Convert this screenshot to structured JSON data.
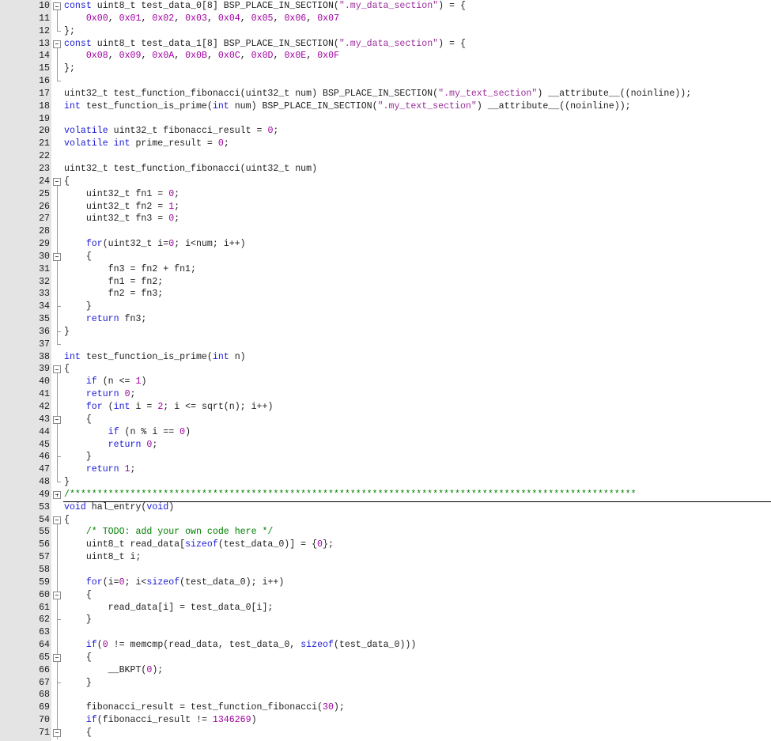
{
  "editor": {
    "lines": [
      {
        "n": "10",
        "fold": "box-start",
        "segs": [
          [
            "kw",
            "const"
          ],
          [
            "p",
            " uint8_t test_data_0[8] BSP_PLACE_IN_SECTION("
          ],
          [
            "str",
            "\".my_data_section\""
          ],
          [
            "p",
            ") = {"
          ]
        ]
      },
      {
        "n": "11",
        "fold": "line",
        "segs": [
          [
            "p",
            "    "
          ],
          [
            "num",
            "0x00"
          ],
          [
            "p",
            ", "
          ],
          [
            "num",
            "0x01"
          ],
          [
            "p",
            ", "
          ],
          [
            "num",
            "0x02"
          ],
          [
            "p",
            ", "
          ],
          [
            "num",
            "0x03"
          ],
          [
            "p",
            ", "
          ],
          [
            "num",
            "0x04"
          ],
          [
            "p",
            ", "
          ],
          [
            "num",
            "0x05"
          ],
          [
            "p",
            ", "
          ],
          [
            "num",
            "0x06"
          ],
          [
            "p",
            ", "
          ],
          [
            "num",
            "0x07"
          ]
        ]
      },
      {
        "n": "12",
        "fold": "end",
        "segs": [
          [
            "p",
            "};"
          ]
        ]
      },
      {
        "n": "13",
        "fold": "box-start",
        "segs": [
          [
            "kw",
            "const"
          ],
          [
            "p",
            " uint8_t test_data_1[8] BSP_PLACE_IN_SECTION("
          ],
          [
            "str",
            "\".my_data_section\""
          ],
          [
            "p",
            ") = {"
          ]
        ]
      },
      {
        "n": "14",
        "fold": "line",
        "segs": [
          [
            "p",
            "    "
          ],
          [
            "num",
            "0x08"
          ],
          [
            "p",
            ", "
          ],
          [
            "num",
            "0x09"
          ],
          [
            "p",
            ", "
          ],
          [
            "num",
            "0x0A"
          ],
          [
            "p",
            ", "
          ],
          [
            "num",
            "0x0B"
          ],
          [
            "p",
            ", "
          ],
          [
            "num",
            "0x0C"
          ],
          [
            "p",
            ", "
          ],
          [
            "num",
            "0x0D"
          ],
          [
            "p",
            ", "
          ],
          [
            "num",
            "0x0E"
          ],
          [
            "p",
            ", "
          ],
          [
            "num",
            "0x0F"
          ]
        ]
      },
      {
        "n": "15",
        "fold": "line",
        "segs": [
          [
            "p",
            "};"
          ]
        ]
      },
      {
        "n": "16",
        "fold": "end",
        "segs": []
      },
      {
        "n": "17",
        "fold": "",
        "segs": [
          [
            "p",
            "uint32_t test_function_fibonacci(uint32_t num) BSP_PLACE_IN_SECTION("
          ],
          [
            "str",
            "\".my_text_section\""
          ],
          [
            "p",
            ") __attribute__((noinline));"
          ]
        ]
      },
      {
        "n": "18",
        "fold": "",
        "segs": [
          [
            "kw",
            "int"
          ],
          [
            "p",
            " test_function_is_prime("
          ],
          [
            "kw",
            "int"
          ],
          [
            "p",
            " num) BSP_PLACE_IN_SECTION("
          ],
          [
            "str",
            "\".my_text_section\""
          ],
          [
            "p",
            ") __attribute__((noinline));"
          ]
        ]
      },
      {
        "n": "19",
        "fold": "",
        "segs": []
      },
      {
        "n": "20",
        "fold": "",
        "segs": [
          [
            "kw",
            "volatile"
          ],
          [
            "p",
            " uint32_t fibonacci_result = "
          ],
          [
            "num",
            "0"
          ],
          [
            "p",
            ";"
          ]
        ]
      },
      {
        "n": "21",
        "fold": "",
        "segs": [
          [
            "kw",
            "volatile"
          ],
          [
            "p",
            " "
          ],
          [
            "kw",
            "int"
          ],
          [
            "p",
            " prime_result = "
          ],
          [
            "num",
            "0"
          ],
          [
            "p",
            ";"
          ]
        ]
      },
      {
        "n": "22",
        "fold": "",
        "segs": []
      },
      {
        "n": "23",
        "fold": "",
        "segs": [
          [
            "p",
            "uint32_t test_function_fibonacci(uint32_t num)"
          ]
        ]
      },
      {
        "n": "24",
        "fold": "box-start",
        "segs": [
          [
            "p",
            "{"
          ]
        ]
      },
      {
        "n": "25",
        "fold": "line",
        "segs": [
          [
            "p",
            "    uint32_t fn1 = "
          ],
          [
            "num",
            "0"
          ],
          [
            "p",
            ";"
          ]
        ]
      },
      {
        "n": "26",
        "fold": "line",
        "segs": [
          [
            "p",
            "    uint32_t fn2 = "
          ],
          [
            "num",
            "1"
          ],
          [
            "p",
            ";"
          ]
        ]
      },
      {
        "n": "27",
        "fold": "line",
        "segs": [
          [
            "p",
            "    uint32_t fn3 = "
          ],
          [
            "num",
            "0"
          ],
          [
            "p",
            ";"
          ]
        ]
      },
      {
        "n": "28",
        "fold": "line",
        "segs": []
      },
      {
        "n": "29",
        "fold": "line",
        "segs": [
          [
            "p",
            "    "
          ],
          [
            "kw",
            "for"
          ],
          [
            "p",
            "(uint32_t i="
          ],
          [
            "num",
            "0"
          ],
          [
            "p",
            "; i<num; i++)"
          ]
        ]
      },
      {
        "n": "30",
        "fold": "box",
        "segs": [
          [
            "p",
            "    {"
          ]
        ]
      },
      {
        "n": "31",
        "fold": "line",
        "segs": [
          [
            "p",
            "        fn3 = fn2 + fn1;"
          ]
        ]
      },
      {
        "n": "32",
        "fold": "line",
        "segs": [
          [
            "p",
            "        fn1 = fn2;"
          ]
        ]
      },
      {
        "n": "33",
        "fold": "line",
        "segs": [
          [
            "p",
            "        fn2 = fn3;"
          ]
        ]
      },
      {
        "n": "34",
        "fold": "tick",
        "segs": [
          [
            "p",
            "    }"
          ]
        ]
      },
      {
        "n": "35",
        "fold": "line",
        "segs": [
          [
            "p",
            "    "
          ],
          [
            "kw",
            "return"
          ],
          [
            "p",
            " fn3;"
          ]
        ]
      },
      {
        "n": "36",
        "fold": "tick",
        "segs": [
          [
            "p",
            "}"
          ]
        ]
      },
      {
        "n": "37",
        "fold": "end",
        "segs": []
      },
      {
        "n": "38",
        "fold": "",
        "segs": [
          [
            "kw",
            "int"
          ],
          [
            "p",
            " test_function_is_prime("
          ],
          [
            "kw",
            "int"
          ],
          [
            "p",
            " n)"
          ]
        ]
      },
      {
        "n": "39",
        "fold": "box-start",
        "segs": [
          [
            "p",
            "{"
          ]
        ]
      },
      {
        "n": "40",
        "fold": "line",
        "segs": [
          [
            "p",
            "    "
          ],
          [
            "kw",
            "if"
          ],
          [
            "p",
            " (n <= "
          ],
          [
            "num",
            "1"
          ],
          [
            "p",
            ")"
          ]
        ]
      },
      {
        "n": "41",
        "fold": "line",
        "segs": [
          [
            "p",
            "    "
          ],
          [
            "kw",
            "return"
          ],
          [
            "p",
            " "
          ],
          [
            "num",
            "0"
          ],
          [
            "p",
            ";"
          ]
        ]
      },
      {
        "n": "42",
        "fold": "line",
        "segs": [
          [
            "p",
            "    "
          ],
          [
            "kw",
            "for"
          ],
          [
            "p",
            " ("
          ],
          [
            "kw",
            "int"
          ],
          [
            "p",
            " i = "
          ],
          [
            "num",
            "2"
          ],
          [
            "p",
            "; i <= sqrt(n); i++)"
          ]
        ]
      },
      {
        "n": "43",
        "fold": "box",
        "segs": [
          [
            "p",
            "    {"
          ]
        ]
      },
      {
        "n": "44",
        "fold": "line",
        "segs": [
          [
            "p",
            "        "
          ],
          [
            "kw",
            "if"
          ],
          [
            "p",
            " (n % i == "
          ],
          [
            "num",
            "0"
          ],
          [
            "p",
            ")"
          ]
        ]
      },
      {
        "n": "45",
        "fold": "line",
        "segs": [
          [
            "p",
            "        "
          ],
          [
            "kw",
            "return"
          ],
          [
            "p",
            " "
          ],
          [
            "num",
            "0"
          ],
          [
            "p",
            ";"
          ]
        ]
      },
      {
        "n": "46",
        "fold": "tick",
        "segs": [
          [
            "p",
            "    }"
          ]
        ]
      },
      {
        "n": "47",
        "fold": "line",
        "segs": [
          [
            "p",
            "    "
          ],
          [
            "kw",
            "return"
          ],
          [
            "p",
            " "
          ],
          [
            "num",
            "1"
          ],
          [
            "p",
            ";"
          ]
        ]
      },
      {
        "n": "48",
        "fold": "end",
        "segs": [
          [
            "p",
            "}"
          ]
        ]
      },
      {
        "n": "49",
        "fold": "plus",
        "segs": [
          [
            "com",
            "/*******************************************************************************************************"
          ]
        ]
      },
      {
        "n": "53",
        "fold": "",
        "segs": [
          [
            "kw",
            "void"
          ],
          [
            "p",
            " hal_entry("
          ],
          [
            "kw",
            "void"
          ],
          [
            "p",
            ")"
          ]
        ]
      },
      {
        "n": "54",
        "fold": "box-start",
        "segs": [
          [
            "p",
            "{"
          ]
        ]
      },
      {
        "n": "55",
        "fold": "line",
        "segs": [
          [
            "p",
            "    "
          ],
          [
            "com",
            "/* TODO: add your own code here */"
          ]
        ]
      },
      {
        "n": "56",
        "fold": "line",
        "segs": [
          [
            "p",
            "    uint8_t read_data["
          ],
          [
            "kw",
            "sizeof"
          ],
          [
            "p",
            "(test_data_0)] = {"
          ],
          [
            "num",
            "0"
          ],
          [
            "p",
            "};"
          ]
        ]
      },
      {
        "n": "57",
        "fold": "line",
        "segs": [
          [
            "p",
            "    uint8_t i;"
          ]
        ]
      },
      {
        "n": "58",
        "fold": "line",
        "segs": []
      },
      {
        "n": "59",
        "fold": "line",
        "segs": [
          [
            "p",
            "    "
          ],
          [
            "kw",
            "for"
          ],
          [
            "p",
            "(i="
          ],
          [
            "num",
            "0"
          ],
          [
            "p",
            "; i<"
          ],
          [
            "kw",
            "sizeof"
          ],
          [
            "p",
            "(test_data_0); i++)"
          ]
        ]
      },
      {
        "n": "60",
        "fold": "box",
        "segs": [
          [
            "p",
            "    {"
          ]
        ]
      },
      {
        "n": "61",
        "fold": "line",
        "segs": [
          [
            "p",
            "        read_data[i] = test_data_0[i];"
          ]
        ]
      },
      {
        "n": "62",
        "fold": "tick",
        "segs": [
          [
            "p",
            "    }"
          ]
        ]
      },
      {
        "n": "63",
        "fold": "line",
        "segs": []
      },
      {
        "n": "64",
        "fold": "line",
        "segs": [
          [
            "p",
            "    "
          ],
          [
            "kw",
            "if"
          ],
          [
            "p",
            "("
          ],
          [
            "num",
            "0"
          ],
          [
            "p",
            " != memcmp(read_data, test_data_0, "
          ],
          [
            "kw",
            "sizeof"
          ],
          [
            "p",
            "(test_data_0)))"
          ]
        ]
      },
      {
        "n": "65",
        "fold": "box",
        "segs": [
          [
            "p",
            "    {"
          ]
        ]
      },
      {
        "n": "66",
        "fold": "line",
        "segs": [
          [
            "p",
            "        __BKPT("
          ],
          [
            "num",
            "0"
          ],
          [
            "p",
            ");"
          ]
        ]
      },
      {
        "n": "67",
        "fold": "tick",
        "segs": [
          [
            "p",
            "    }"
          ]
        ]
      },
      {
        "n": "68",
        "fold": "line",
        "segs": []
      },
      {
        "n": "69",
        "fold": "line",
        "segs": [
          [
            "p",
            "    fibonacci_result = test_function_fibonacci("
          ],
          [
            "num",
            "30"
          ],
          [
            "p",
            ");"
          ]
        ]
      },
      {
        "n": "70",
        "fold": "line",
        "segs": [
          [
            "p",
            "    "
          ],
          [
            "kw",
            "if"
          ],
          [
            "p",
            "(fibonacci_result != "
          ],
          [
            "num",
            "1346269"
          ],
          [
            "p",
            ")"
          ]
        ]
      },
      {
        "n": "71",
        "fold": "box",
        "segs": [
          [
            "p",
            "    {"
          ]
        ]
      }
    ]
  }
}
